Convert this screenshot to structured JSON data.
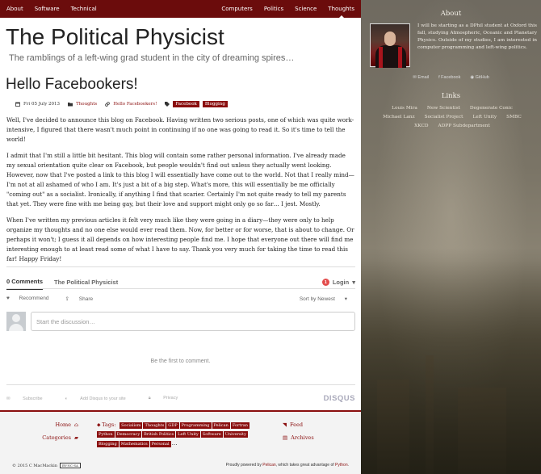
{
  "nav": {
    "left": [
      "About",
      "Software",
      "Technical"
    ],
    "right": [
      "Computers",
      "Politics",
      "Science",
      "Thoughts"
    ]
  },
  "site": {
    "title": "The Political Physicist",
    "subtitle": "The ramblings of a left-wing grad student in the city of dreaming spires…"
  },
  "post": {
    "title": "Hello Facebookers!",
    "date": "Fri 05 July 2013",
    "category": "Thoughts",
    "permalink": "Hello Facebookers!",
    "tags": [
      "Facebook",
      "Blogging"
    ],
    "paragraphs": [
      "Well, I've decided to announce this blog on Facebook. Having written two serious posts, one of which was quite work-intensive, I figured that there wasn't much point in continuing if no one was going to read it. So it's time to tell the world!",
      "I admit that I'm still a little bit hesitant. This blog will contain some rather personal information. I've already made my sexual orientation quite clear on Facebook, but people wouldn't find out unless they actually went looking. However, now that I've posted a link to this blog I will essentially have come out to the world. Not that I really mind—I'm not at all ashamed of who I am. It's just a bit of a big step. What's more, this will essentially be me officially \"coming out\" as a socialist. Ironically, if anything I find that scarier. Certainly I'm not quite ready to tell my parents that yet. They were fine with me being gay, but their love and support might only go so far… I jest. Mostly.",
      "When I've written my previous articles it felt very much like they were going in a diary—they were only to help organize my thoughts and no one else would ever read them. Now, for better or for worse, that is about to change. Or perhaps it won't; I guess it all depends on how interesting people find me. I hope that everyone out there will find me interesting enough to at least read some of what I have to say. Thank you very much for taking the time to read this far! Happy Friday!"
    ]
  },
  "disqus": {
    "comments_tab": "0 Comments",
    "site_tab": "The Political Physicist",
    "login_badge": "1",
    "login": "Login",
    "recommend": "Recommend",
    "share": "Share",
    "sort": "Sort by Newest",
    "placeholder": "Start the discussion…",
    "empty": "Be the first to comment.",
    "subscribe": "Subscribe",
    "add_disqus": "Add Disqus to your site",
    "privacy": "Privacy",
    "logo": "DISQUS"
  },
  "footer": {
    "home": "Home",
    "categories": "Categories",
    "tags_label": "Tags:",
    "tags": [
      "Socialism",
      "Thoughts",
      "GDP",
      "Programming",
      "Pelican",
      "Fortran",
      "Python",
      "Democracy",
      "British Politics",
      "Left Unity",
      "Software",
      "University",
      "Blogging",
      "Mathematics",
      "Personal"
    ],
    "more": "…",
    "feed": "Feed",
    "archives": "Archives",
    "copyright": "© 2015 C MacMackin",
    "cc": "BY-NC-SA",
    "powered_prefix": "Proudly powered by ",
    "pelican": "Pelican",
    "powered_mid": ", which takes great advantage of ",
    "python": "Python",
    "powered_suffix": "."
  },
  "sidebar": {
    "about_title": "About",
    "about_text": "I will be starting as a DPhil student at Oxford this fall, studying Atmospheric, Oceanic and Planetary Physics. Outside of my studies, I am interested in computer programming and left-wing politics.",
    "contact": [
      "Email",
      "Facebook",
      "GitHub"
    ],
    "links_title": "Links",
    "links": [
      "Louis Mira",
      "New Scientist",
      "Degenerate Conic",
      "Michael Lanz",
      "Socialist Project",
      "Left Unity",
      "SMBC",
      "XKCD",
      "ADPP Subdepartment"
    ]
  },
  "colors": {
    "accent": "#8a0e0e",
    "nav": "#6b0c0c"
  }
}
